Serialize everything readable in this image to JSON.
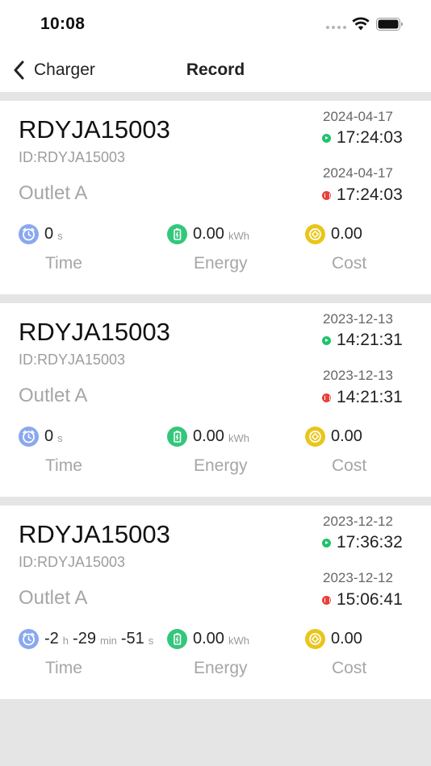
{
  "status_bar": {
    "time": "10:08"
  },
  "nav": {
    "back_label": "Charger",
    "title": "Record"
  },
  "labels": {
    "time": "Time",
    "energy": "Energy",
    "cost": "Cost"
  },
  "units": {
    "h": "h",
    "min": "min",
    "s": "s",
    "kwh": "kWh"
  },
  "colors": {
    "start_dot": "#21c26a",
    "end_dot": "#e8413a",
    "time_icon": "#8aa8ef",
    "energy_icon": "#34c77b",
    "cost_icon": "#eac51a"
  },
  "records": [
    {
      "name": "RDYJA15003",
      "id": "ID:RDYJA15003",
      "outlet": "Outlet A",
      "start_date": "2024-04-17",
      "start_time": "17:24:03",
      "end_date": "2024-04-17",
      "end_time": "17:24:03",
      "duration_h": "",
      "duration_min": "",
      "duration_s": "0",
      "energy": "0.00",
      "cost": "0.00"
    },
    {
      "name": "RDYJA15003",
      "id": "ID:RDYJA15003",
      "outlet": "Outlet A",
      "start_date": "2023-12-13",
      "start_time": "14:21:31",
      "end_date": "2023-12-13",
      "end_time": "14:21:31",
      "duration_h": "",
      "duration_min": "",
      "duration_s": "0",
      "energy": "0.00",
      "cost": "0.00"
    },
    {
      "name": "RDYJA15003",
      "id": "ID:RDYJA15003",
      "outlet": "Outlet A",
      "start_date": "2023-12-12",
      "start_time": "17:36:32",
      "end_date": "2023-12-12",
      "end_time": "15:06:41",
      "duration_h": "-2",
      "duration_min": "-29",
      "duration_s": "-51",
      "energy": "0.00",
      "cost": "0.00"
    }
  ]
}
